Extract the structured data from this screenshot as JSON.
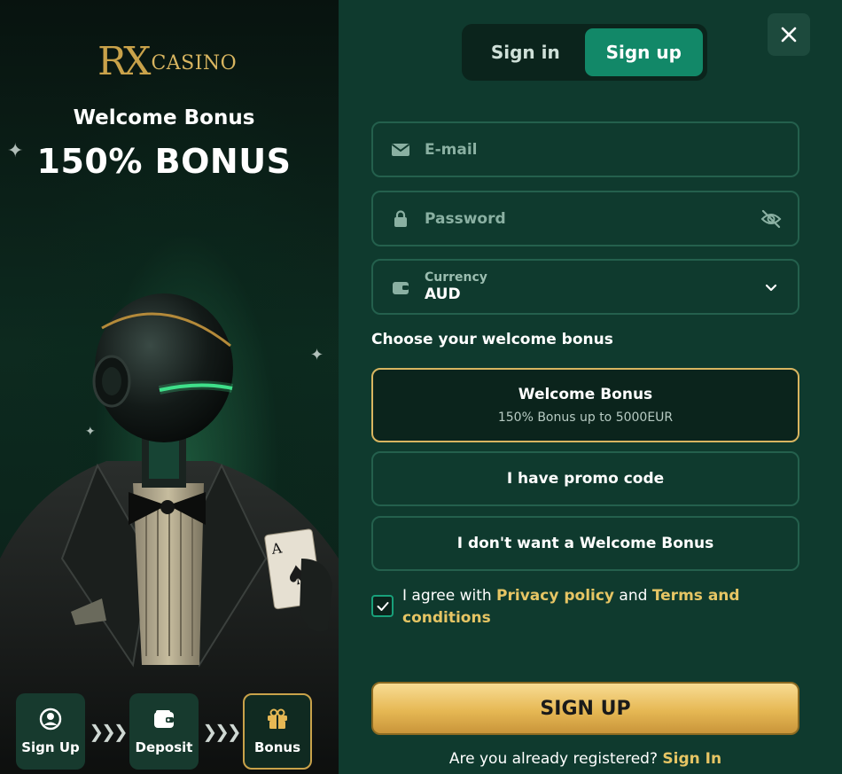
{
  "brand": {
    "logo_rx": "RX",
    "logo_casino": "CASINO"
  },
  "promo": {
    "title": "Welcome Bonus",
    "headline": "150% BONUS"
  },
  "steps": [
    {
      "label": "Sign Up",
      "icon": "user-circle-icon"
    },
    {
      "label": "Deposit",
      "icon": "wallet-icon"
    },
    {
      "label": "Bonus",
      "icon": "gift-icon"
    }
  ],
  "step_arrows": "❯❯❯",
  "tabs": {
    "sign_in": "Sign in",
    "sign_up": "Sign up",
    "active": "sign_up"
  },
  "form": {
    "email_placeholder": "E-mail",
    "password_placeholder": "Password",
    "currency_label": "Currency",
    "currency_value": "AUD"
  },
  "bonus": {
    "heading": "Choose your welcome bonus",
    "options": [
      {
        "title": "Welcome Bonus",
        "subtitle": "150% Bonus up to 5000EUR",
        "selected": true
      },
      {
        "title": "I have promo code"
      },
      {
        "title": "I don't want a Welcome Bonus"
      }
    ]
  },
  "agreement": {
    "checked": true,
    "prefix": "I agree with ",
    "privacy": "Privacy policy",
    "middle": " and ",
    "terms": "Terms and conditions"
  },
  "signup_button": "SIGN UP",
  "footer": {
    "question": "Are you already registered? ",
    "link": "Sign In"
  },
  "colors": {
    "accent_green": "#128868",
    "gold": "#e6c564",
    "panel": "#0f3a2e"
  }
}
